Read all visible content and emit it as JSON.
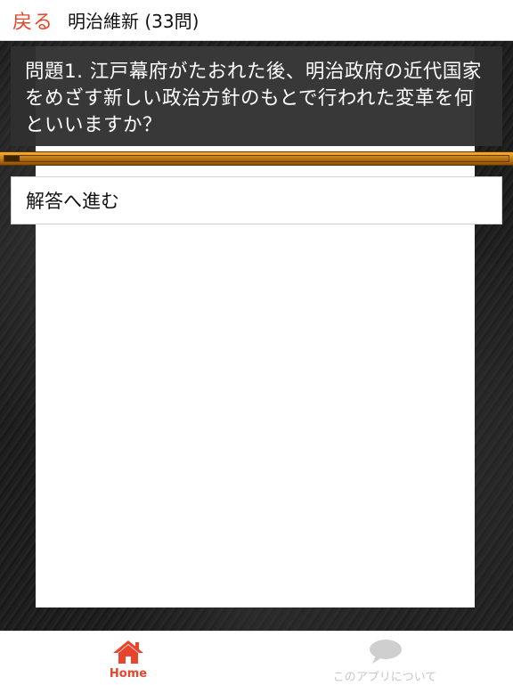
{
  "header": {
    "back_label": "戻る",
    "title": "明治維新 (33問)"
  },
  "question": {
    "text": "問題1. 江戸幕府がたおれた後、明治政府の近代国家をめざす新しい政治方針のもとで行われた変革を何といいますか？"
  },
  "progress": {
    "fraction": 0.03
  },
  "answer": {
    "label": "解答へ進む"
  },
  "tabbar": {
    "home_label": "Home",
    "about_label": "このアプリについて"
  },
  "colors": {
    "accent": "#e8452c",
    "inactive": "#c8c8c8",
    "progress": "#c57a10"
  },
  "icons": {
    "home": "home-icon",
    "about": "speech-bubble-icon"
  }
}
